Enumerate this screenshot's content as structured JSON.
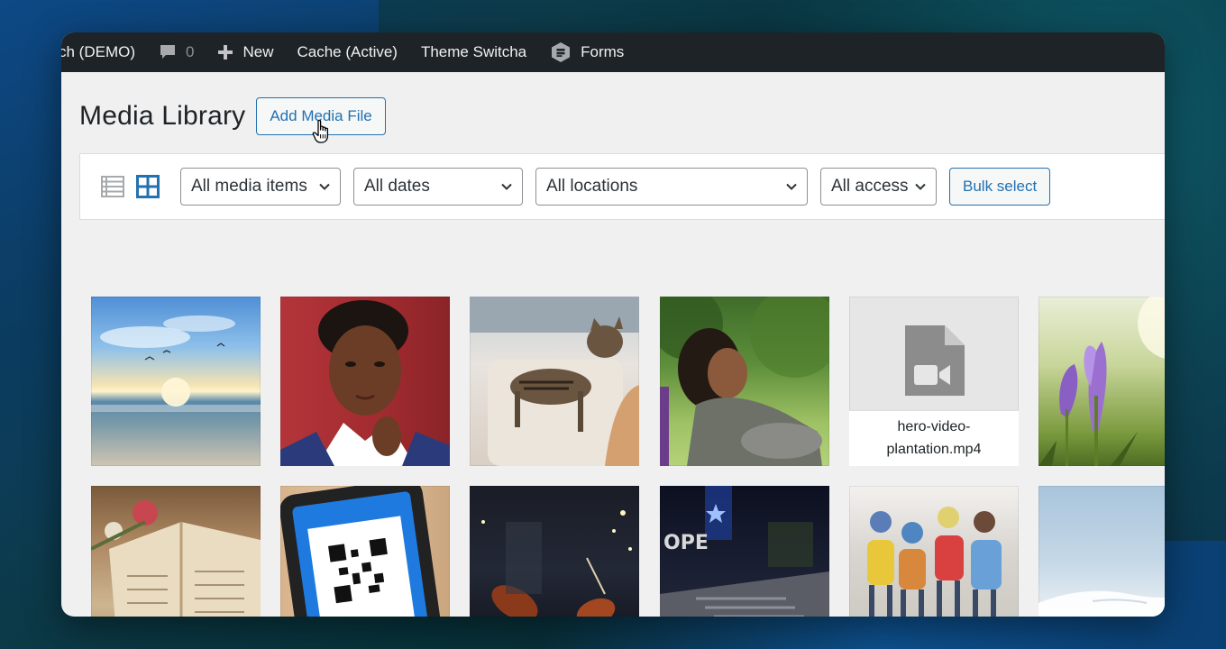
{
  "admin_bar": {
    "site_name": "ch (DEMO)",
    "comments_count": "0",
    "new_label": "New",
    "cache_label": "Cache (Active)",
    "theme_label": "Theme Switcha",
    "forms_label": "Forms"
  },
  "page": {
    "title": "Media Library",
    "add_button": "Add Media File"
  },
  "filters": {
    "media_type": "All media items",
    "dates": "All dates",
    "locations": "All locations",
    "access": "All access",
    "bulk_select": "Bulk select"
  },
  "media": [
    {
      "type": "image",
      "subject": "beach-sunset"
    },
    {
      "type": "image",
      "subject": "woman-portrait"
    },
    {
      "type": "image",
      "subject": "cat-on-chair"
    },
    {
      "type": "image",
      "subject": "woman-laughing-park"
    },
    {
      "type": "video",
      "filename": "hero-video-plantation.mp4"
    },
    {
      "type": "image",
      "subject": "purple-crocus"
    },
    {
      "type": "image",
      "subject": "book-and-rose"
    },
    {
      "type": "image",
      "subject": "phone-qr-code"
    },
    {
      "type": "image",
      "subject": "violins-stage"
    },
    {
      "type": "image",
      "subject": "concert-stage"
    },
    {
      "type": "image",
      "subject": "children-walking"
    },
    {
      "type": "image",
      "subject": "snowy-mountain"
    }
  ],
  "colors": {
    "accent": "#2271b1",
    "admin_bar_bg": "#1d2327",
    "page_bg": "#f0f0f1"
  }
}
